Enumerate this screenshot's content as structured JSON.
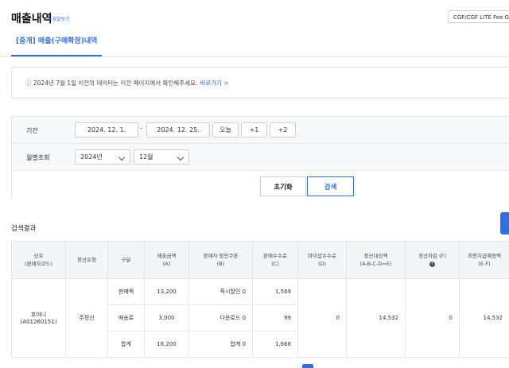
{
  "page": {
    "title": "매출내역",
    "help_link": "도움말보기",
    "fee_select": "CGF/CGF LITE Fee Guide"
  },
  "tabs": [
    {
      "label": "[중개] 매출(구매확정)내역"
    }
  ],
  "notice": {
    "text": "ⓘ 2024년 7월 1일 이전의 데이터는 이전 페이지에서 확인해주세요.",
    "link": "바로가기 >"
  },
  "filter": {
    "period_label": "기간",
    "start_date": "2024. 12. 1.",
    "separator": "-",
    "end_date": "2024. 12. 25.",
    "quick_buttons": [
      "오늘",
      "+1",
      "+2"
    ],
    "monthly_label": "월별조회",
    "year_value": "2024년",
    "month_value": "12월",
    "reset_label": "초기화",
    "search_label": "검색"
  },
  "results": {
    "title": "검색결과",
    "headers": [
      [
        "상호",
        "(판매자코드)"
      ],
      [
        "정산유형"
      ],
      [
        "구분"
      ],
      [
        "매출금액",
        "(A)"
      ],
      [
        "판매자 할인쿠폰",
        "(B)"
      ],
      [
        "판매수수료",
        "(C)"
      ],
      [
        "마이샵수수료",
        "(D)"
      ],
      [
        "정산대상액",
        "(A-B-C-D=E)"
      ],
      [
        "정산차감 (F)"
      ],
      [
        "최종지급예정액",
        "(E-F)"
      ]
    ],
    "seller": [
      "호야니",
      "(A01260151)"
    ],
    "settlement_type": "주정산",
    "rows": [
      {
        "category": "판매액",
        "sales": "13,200",
        "coupon": "즉시할인 0",
        "fee": "1,569"
      },
      {
        "category": "배송료",
        "sales": "3,000",
        "coupon": "다운로드 0",
        "fee": "99"
      },
      {
        "category": "합계",
        "sales": "16,200",
        "coupon": "합계 0",
        "fee": "1,668"
      }
    ],
    "myshop_fee": "0",
    "settlement_amount": "14,532",
    "deduction": "0",
    "final_amount": "14,532"
  }
}
